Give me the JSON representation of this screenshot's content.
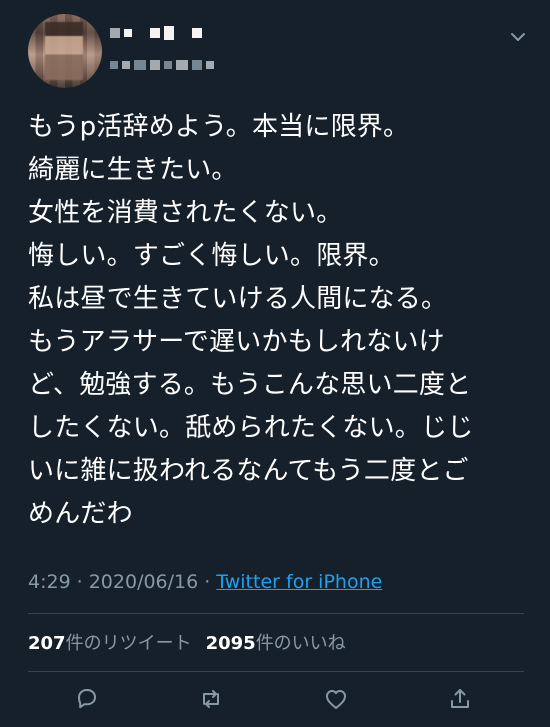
{
  "tweet": {
    "lines": [
      "もうp活辞めよう。本当に限界。",
      "綺麗に生きたい。",
      "女性を消費されたくない。",
      "悔しい。すごく悔しい。限界。",
      "私は昼で生きていける人間になる。",
      "もうアラサーで遅いかもしれないけ",
      "ど、勉強する。もうこんな思い二度と",
      "したくない。舐められたくない。じじ",
      "いに雑に扱われるなんてもう二度とご",
      "めんだわ"
    ],
    "time": "4:29",
    "date": "2020/06/16",
    "source": "Twitter for iPhone"
  },
  "separators": {
    "meta_dot_1": "·",
    "meta_dot_2": "·"
  },
  "stats": {
    "retweets_count": "207",
    "retweets_label": "件のリツイート",
    "likes_count": "2095",
    "likes_label": "件のいいね"
  },
  "icons": {
    "menu": "chevron-down-icon",
    "reply": "reply-icon",
    "retweet": "retweet-icon",
    "like": "heart-icon",
    "share": "share-icon"
  },
  "colors": {
    "background": "#15202b",
    "text": "#ffffff",
    "secondary": "#8899a6",
    "link": "#1da1f2",
    "divider": "#38444d"
  }
}
